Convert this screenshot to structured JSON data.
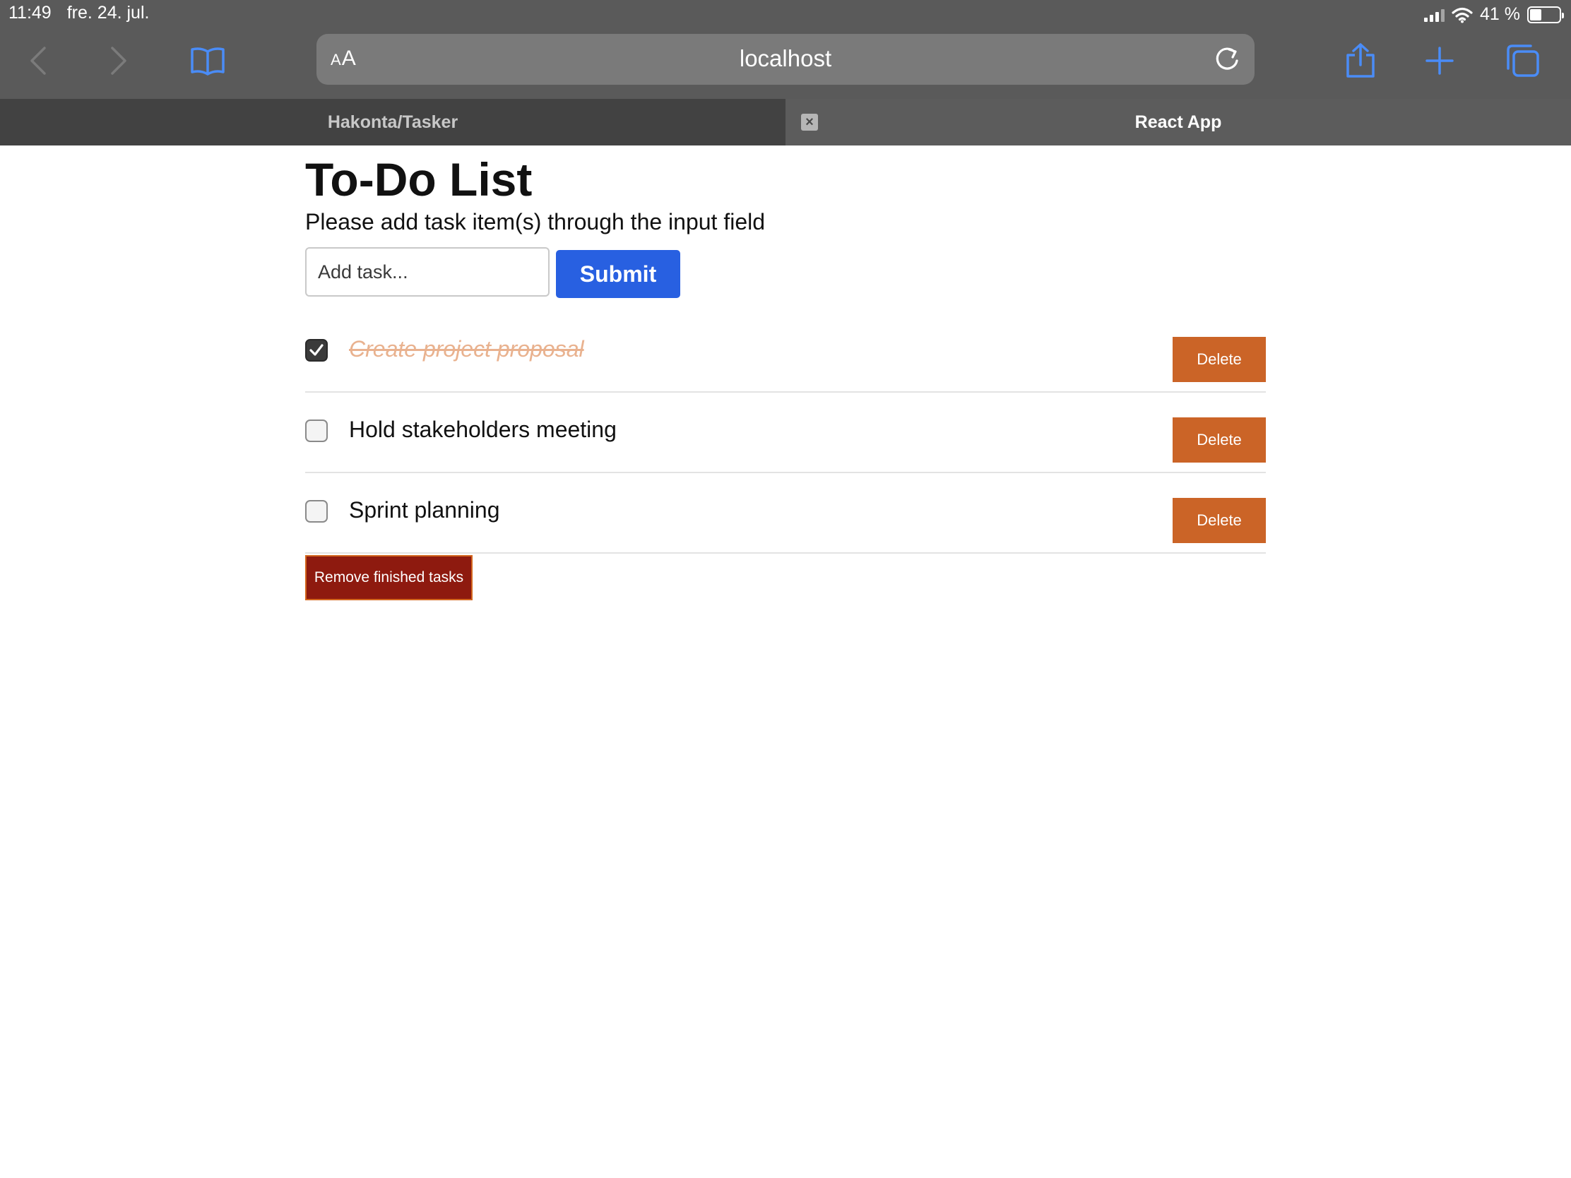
{
  "status_bar": {
    "time": "11:49",
    "date": "fre. 24. jul.",
    "battery": "41 %",
    "battery_level": 0.41
  },
  "browser": {
    "reader_label": "AA",
    "url": "localhost",
    "tabs": [
      {
        "label": "Hakonta/Tasker",
        "active": false
      },
      {
        "label": "React App",
        "active": true
      }
    ],
    "accent_color": "#4a8cf7"
  },
  "page": {
    "title": "To-Do List",
    "subtitle": "Please add task item(s) through the input field",
    "input_placeholder": "Add task...",
    "submit_label": "Submit",
    "tasks": [
      {
        "label": "Create project proposal",
        "done": true,
        "delete_label": "Delete"
      },
      {
        "label": "Hold stakeholders meeting",
        "done": false,
        "delete_label": "Delete"
      },
      {
        "label": "Sprint planning",
        "done": false,
        "delete_label": "Delete"
      }
    ],
    "remove_finished_label": "Remove finished tasks",
    "colors": {
      "submit": "#2860e1",
      "delete": "#cb6427",
      "remove_finished": "#8e1a0f",
      "done_text": "#e9b28f"
    }
  }
}
